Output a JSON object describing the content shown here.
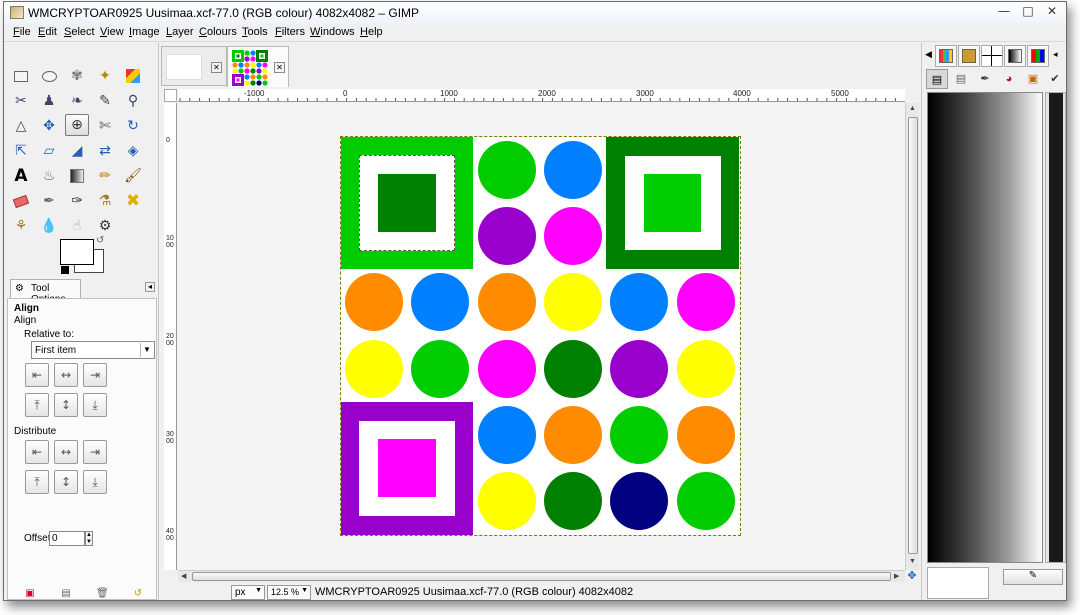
{
  "window": {
    "title": "WMCRYPTOAR0925 Uusimaa.xcf-77.0 (RGB colour) 4082x4082 – GIMP",
    "minimize_icon": "minimize-icon",
    "maximize_icon": "maximize-icon",
    "close_icon": "close-icon"
  },
  "menubar": {
    "items": [
      "File",
      "Edit",
      "Select",
      "View",
      "Image",
      "Layer",
      "Colours",
      "Tools",
      "Filters",
      "Windows",
      "Help"
    ]
  },
  "toolbox": {
    "tools": [
      "rect-select-icon",
      "ellipse-select-icon",
      "free-select-icon",
      "fuzzy-select-icon",
      "select-by-color-icon",
      "scissors-icon",
      "foreground-select-icon",
      "paths-icon",
      "color-picker-icon",
      "zoom-icon",
      "measure-icon",
      "move-icon",
      "align-icon",
      "crop-icon",
      "rotate-icon",
      "scale-icon",
      "shear-icon",
      "perspective-icon",
      "flip-icon",
      "cage-icon",
      "text-icon",
      "bucket-fill-icon",
      "blend-icon",
      "pencil-icon",
      "paintbrush-icon",
      "eraser-icon",
      "airbrush-icon",
      "ink-icon",
      "clone-icon",
      "heal-icon",
      "perspective-clone-icon",
      "blur-icon",
      "smudge-icon",
      "dodge-burn-icon"
    ],
    "active_tool": "align-icon",
    "tool_options": {
      "tab_label": "Tool Options",
      "title": "Align",
      "subtitle": "Align",
      "relative_to_label": "Relative to:",
      "relative_to_value": "First item",
      "distribute_label": "Distribute",
      "offset_label": "Offset:",
      "offset_value": "0"
    }
  },
  "image_tabs": [
    {
      "name": "blank-image",
      "active": false
    },
    {
      "name": "uusimaa-image",
      "active": true
    }
  ],
  "rulers": {
    "horizontal": [
      "-1000",
      "0",
      "1000",
      "2000",
      "3000",
      "4000",
      "5000"
    ],
    "vertical": [
      "0",
      "1000",
      "2000",
      "3000",
      "4000"
    ]
  },
  "image": {
    "square_blocks": [
      {
        "name": "green-square-block",
        "outer": "#00cc00",
        "inner": "#008000"
      },
      {
        "name": "darkgreen-square-block",
        "outer": "#008000",
        "inner": "#00cc00"
      },
      {
        "name": "purple-square-block",
        "outer": "#9900cc",
        "inner": "#ff00ff"
      }
    ],
    "circles": [
      "#00cc00",
      "#0080ff",
      "#9900cc",
      "#ff00ff",
      "#ff8c00",
      "#0080ff",
      "#ff8c00",
      "#ffff00",
      "#0080ff",
      "#ff00ff",
      "#ffff00",
      "#00cc00",
      "#ff00ff",
      "#008000",
      "#9900cc",
      "#ffff00",
      "#0080ff",
      "#ff8c00",
      "#00cc00",
      "#ff8c00",
      "#ffff00",
      "#008000",
      "#000080",
      "#00cc00"
    ]
  },
  "statusbar": {
    "unit": "px",
    "zoom": "12.5 %",
    "text": "WMCRYPTOAR0925 Uusimaa.xcf-77.0 (RGB colour) 4082x4082"
  }
}
